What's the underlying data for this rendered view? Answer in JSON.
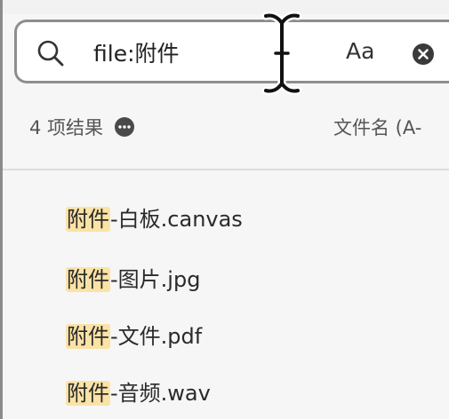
{
  "search": {
    "query": "file:附件",
    "case_label": "Aa"
  },
  "results": {
    "count_label": "4 项结果",
    "sort_label": "文件名 (A-",
    "items": [
      {
        "match": "附件",
        "rest": "-白板.canvas"
      },
      {
        "match": "附件",
        "rest": "-图片.jpg"
      },
      {
        "match": "附件",
        "rest": "-文件.pdf"
      },
      {
        "match": "附件",
        "rest": "-音频.wav"
      }
    ]
  },
  "colors": {
    "highlight": "#fbe3a6",
    "search_border": "#8e8e8e"
  },
  "icons": [
    "search-icon",
    "text-cursor-icon",
    "clear-icon",
    "more-icon"
  ]
}
